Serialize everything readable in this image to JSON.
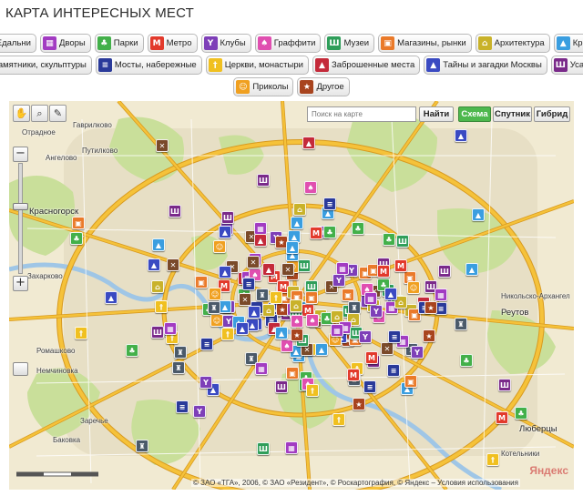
{
  "title": "КАРТА ИНТЕРЕСНЫХ МЕСТ",
  "categories_row1": [
    {
      "label": "Едальни",
      "icon": "fork-knife-icon",
      "color": "#7a4a2a",
      "glyph": "✕"
    },
    {
      "label": "Дворы",
      "icon": "courtyard-icon",
      "color": "#a23bc2",
      "glyph": "▦"
    },
    {
      "label": "Парки",
      "icon": "tree-icon",
      "color": "#43b04a",
      "glyph": "♣"
    },
    {
      "label": "Метро",
      "icon": "metro-icon",
      "color": "#e23a2c",
      "glyph": "M"
    },
    {
      "label": "Клубы",
      "icon": "cocktail-icon",
      "color": "#7e3fb8",
      "glyph": "Y"
    },
    {
      "label": "Граффити",
      "icon": "spray-icon",
      "color": "#e04fb0",
      "glyph": "♠"
    },
    {
      "label": "Музеи",
      "icon": "museum-icon",
      "color": "#2f9e5a",
      "glyph": "Ш"
    },
    {
      "label": "Магазины, рынки",
      "icon": "shop-icon",
      "color": "#ea7a2a",
      "glyph": "▣"
    },
    {
      "label": "Архитектура",
      "icon": "architecture-icon",
      "color": "#c9b22a",
      "glyph": "⌂"
    },
    {
      "label": "Крыши",
      "icon": "roof-icon",
      "color": "#3a9ee0",
      "glyph": "▲"
    }
  ],
  "categories_row2": [
    {
      "label": "Памятники, скульптуры",
      "icon": "monument-icon",
      "color": "#4b5a6a",
      "glyph": "♜"
    },
    {
      "label": "Мосты, набережные",
      "icon": "bridge-icon",
      "color": "#2a3a9a",
      "glyph": "≡"
    },
    {
      "label": "Церкви, монастыри",
      "icon": "church-icon",
      "color": "#f0c020",
      "glyph": "†"
    },
    {
      "label": "Заброшенные места",
      "icon": "abandoned-icon",
      "color": "#c42a3a",
      "glyph": "▲"
    },
    {
      "label": "Тайны и загадки Москвы",
      "icon": "mystery-icon",
      "color": "#3a4ac2",
      "glyph": "▲"
    },
    {
      "label": "Усадьбы",
      "icon": "manor-icon",
      "color": "#7a2a8a",
      "glyph": "Ш"
    }
  ],
  "categories_row3": [
    {
      "label": "Приколы",
      "icon": "smiley-icon",
      "color": "#f0a020",
      "glyph": "☺"
    },
    {
      "label": "Другое",
      "icon": "star-icon",
      "color": "#a8441e",
      "glyph": "★"
    }
  ],
  "map_controls": {
    "search_placeholder": "Поиск на карте",
    "find_label": "Найти",
    "scheme_label": "Схема",
    "satellite_label": "Спутник",
    "hybrid_label": "Гибрид",
    "zoom_in": "+",
    "zoom_out": "−"
  },
  "place_labels": [
    {
      "text": "Гаврилково",
      "cls": "",
      "at": "l1"
    },
    {
      "text": "Отрадное",
      "cls": "",
      "at": "l2"
    },
    {
      "text": "Путилково",
      "cls": "",
      "at": "l3"
    },
    {
      "text": "Ангелово",
      "cls": "",
      "at": "l4"
    },
    {
      "text": "Красногорск",
      "cls": "big",
      "at": "l5"
    },
    {
      "text": "Захарково",
      "cls": "",
      "at": "l6"
    },
    {
      "text": "Ромашково",
      "cls": "",
      "at": "l7"
    },
    {
      "text": "Немчиновка",
      "cls": "",
      "at": "l8"
    },
    {
      "text": "Заречье",
      "cls": "",
      "at": "l9"
    },
    {
      "text": "Баковка",
      "cls": "",
      "at": "l10"
    },
    {
      "text": "Реутов",
      "cls": "big",
      "at": "l11"
    },
    {
      "text": "Никольско-Архангел",
      "cls": "",
      "at": "l12"
    },
    {
      "text": "Люберцы",
      "cls": "big",
      "at": "l13"
    },
    {
      "text": "Котельники",
      "cls": "",
      "at": "l14"
    }
  ],
  "copyright": "© ЗАО «ТГА», 2006, © ЗАО «Резидент», © Роскартография, © Яндекс – Условия использования",
  "logo_text": "Яндекс",
  "colors": {
    "map_bg": "#f1ead2",
    "road_major": "#f5c23a",
    "road_outline": "#d89a20",
    "park": "#c9df9a",
    "water": "#9fc6e6",
    "city_block": "#e4dcc4",
    "active_button": "#4db84d"
  }
}
